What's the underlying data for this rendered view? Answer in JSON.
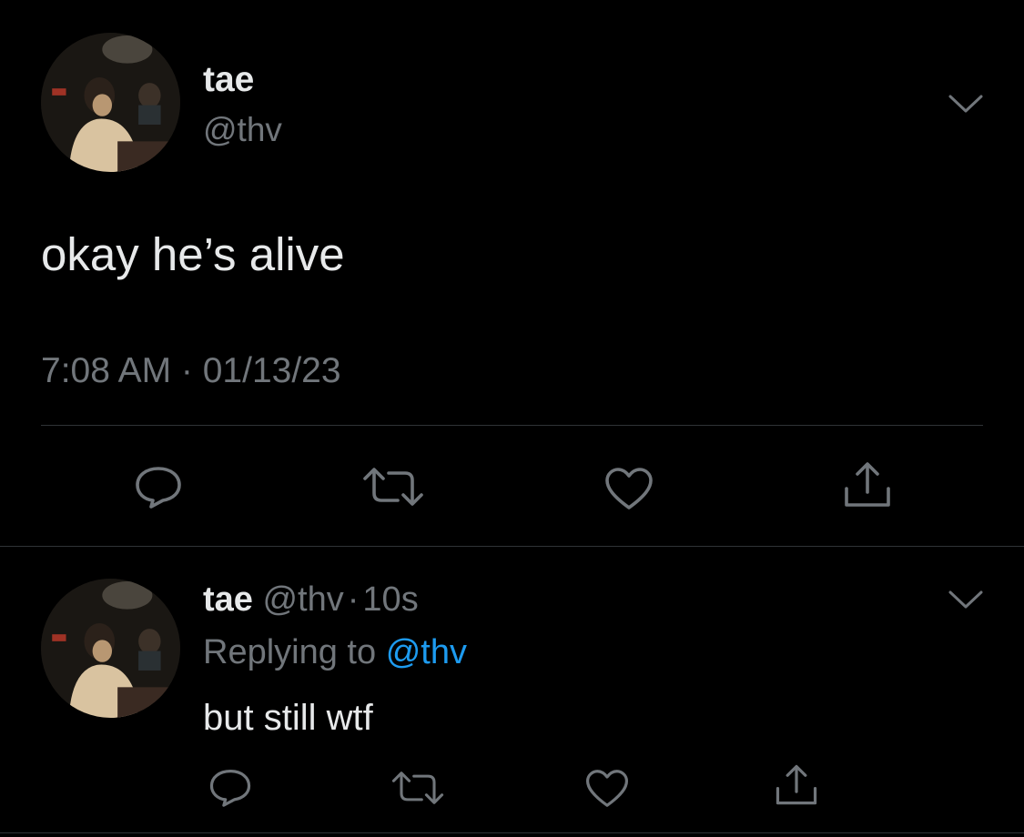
{
  "main_tweet": {
    "display_name": "tae",
    "handle": "@thv",
    "text": "okay he’s alive",
    "timestamp": "7:08 AM · 01/13/23",
    "icons": [
      "reply-icon",
      "retweet-icon",
      "like-icon",
      "share-icon",
      "chevron-down-icon"
    ]
  },
  "reply_tweet": {
    "display_name": "tae",
    "handle": "@thv",
    "separator": "·",
    "age": "10s",
    "replying_prefix": "Replying to",
    "replying_handle": "@thv",
    "text": "but still wtf",
    "icons": [
      "reply-icon",
      "retweet-icon",
      "like-icon",
      "share-icon",
      "chevron-down-icon"
    ]
  },
  "colors": {
    "background": "#000000",
    "text": "#e7e9ea",
    "muted": "#71767b",
    "link": "#1d9bf0",
    "divider": "#2f3336"
  }
}
